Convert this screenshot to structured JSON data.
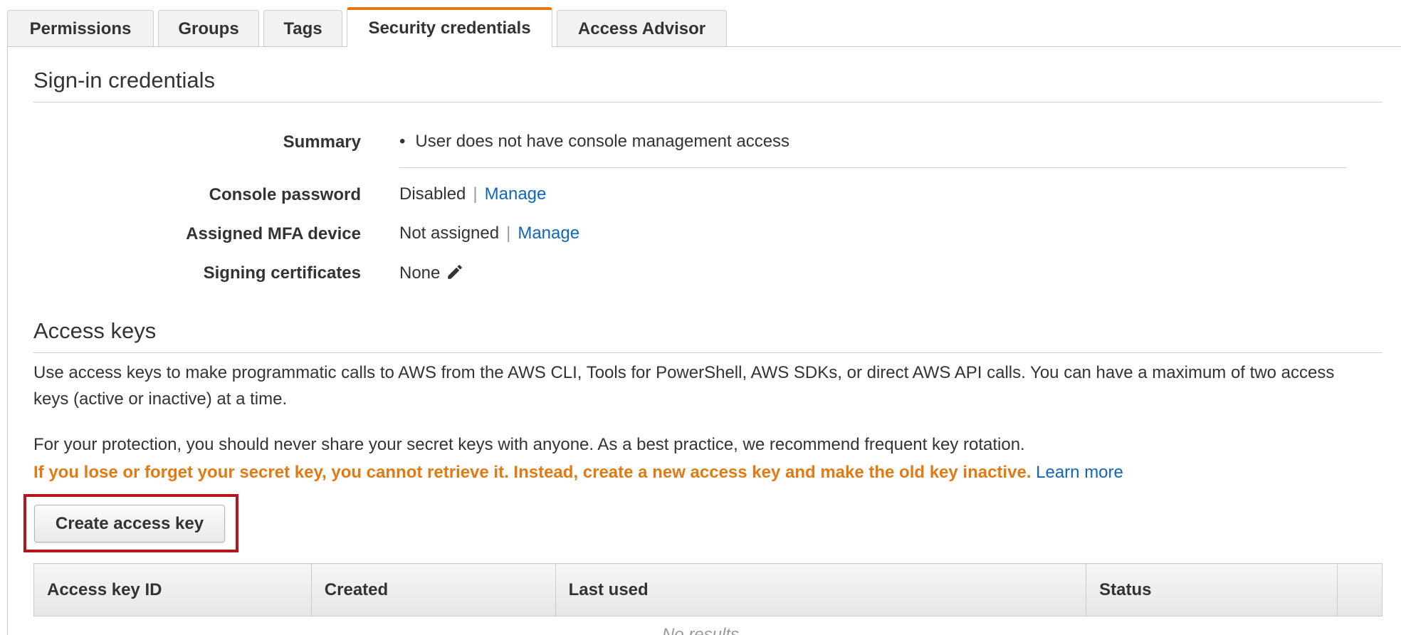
{
  "tabs": [
    {
      "label": "Permissions",
      "active": false
    },
    {
      "label": "Groups",
      "active": false
    },
    {
      "label": "Tags",
      "active": false
    },
    {
      "label": "Security credentials",
      "active": true
    },
    {
      "label": "Access Advisor",
      "active": false
    }
  ],
  "signin": {
    "title": "Sign-in credentials",
    "summary_label": "Summary",
    "summary_value": "User does not have console management access",
    "console_password_label": "Console password",
    "console_password_value": "Disabled",
    "console_password_link": "Manage",
    "mfa_label": "Assigned MFA device",
    "mfa_value": "Not assigned",
    "mfa_link": "Manage",
    "signing_label": "Signing certificates",
    "signing_value": "None",
    "edit_icon": "pencil-icon"
  },
  "access_keys": {
    "title": "Access keys",
    "description": "Use access keys to make programmatic calls to AWS from the AWS CLI, Tools for PowerShell, AWS SDKs, or direct AWS API calls. You can have a maximum of two access keys (active or inactive) at a time.",
    "protection_note": "For your protection, you should never share your secret keys with anyone. As a best practice, we recommend frequent key rotation.",
    "warning": "If you lose or forget your secret key, you cannot retrieve it. Instead, create a new access key and make the old key inactive.",
    "learn_more": "Learn more",
    "create_button": "Create access key",
    "columns": [
      "Access key ID",
      "Created",
      "Last used",
      "Status",
      ""
    ],
    "empty_text": "No results"
  },
  "colors": {
    "accent_tab": "#e07b13",
    "link": "#1166bb",
    "warning": "#e07b13",
    "highlight_box": "#b7151c"
  }
}
